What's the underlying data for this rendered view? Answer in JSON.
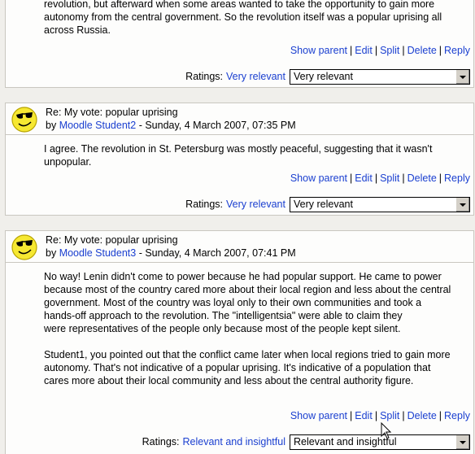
{
  "post1": {
    "body_lines": [
      "revolution, but afterward when some areas wanted to take the opportunity to gain more",
      "autonomy from the central government. So the revolution itself was a popular uprising all",
      "across Russia."
    ],
    "commands": {
      "show_parent": "Show parent",
      "edit": "Edit",
      "split": "Split",
      "delete": "Delete",
      "reply": "Reply"
    },
    "ratings_label": "Ratings:",
    "ratings_value": "Very relevant",
    "select_value": "Very relevant"
  },
  "post2": {
    "subject": "Re: My vote: popular uprising",
    "by": "by",
    "author": "Moodle Student2",
    "date": "- Sunday, 4 March 2007, 07:35 PM",
    "body_lines": [
      "I agree. The revolution in St. Petersburg was mostly peaceful, suggesting that it wasn't",
      "unpopular."
    ],
    "commands": {
      "show_parent": "Show parent",
      "edit": "Edit",
      "split": "Split",
      "delete": "Delete",
      "reply": "Reply"
    },
    "ratings_label": "Ratings:",
    "ratings_value": "Very relevant",
    "select_value": "Very relevant"
  },
  "post3": {
    "subject": "Re: My vote: popular uprising",
    "by": "by",
    "author": "Moodle Student3",
    "date": "- Sunday, 4 March 2007, 07:41 PM",
    "para1_lines": [
      "No way! Lenin didn't come to power because he had popular support. He came to power",
      "because most of the country cared more about their local region and less about the central",
      "government. Most of the country was loyal only to their own communities and took a",
      "hands-off approach to the revolution. The \"intelligentsia\" were able to claim they",
      "were representatives of the people only because most of the people kept silent."
    ],
    "para2_lines": [
      "Student1, you pointed out that the conflict came later when local regions tried to gain more",
      "autonomy. That's not indicative of a popular uprising. It's indicative of a population that",
      "cares more about their local community and less about the central authority figure."
    ],
    "commands": {
      "show_parent": "Show parent",
      "edit": "Edit",
      "split": "Split",
      "delete": "Delete",
      "reply": "Reply"
    },
    "ratings_label": "Ratings:",
    "ratings_value": "Relevant and insightful",
    "select_value": "Relevant and insightful"
  },
  "separator": "|",
  "colors": {
    "link": "#1a3fd0",
    "page_bg": "#f0efeb",
    "post_bg": "#fdfdfc",
    "border": "#c9c7c0"
  },
  "icons": {
    "avatar": "smiley-sunglasses-icon",
    "cursor": "mouse-pointer-icon"
  }
}
